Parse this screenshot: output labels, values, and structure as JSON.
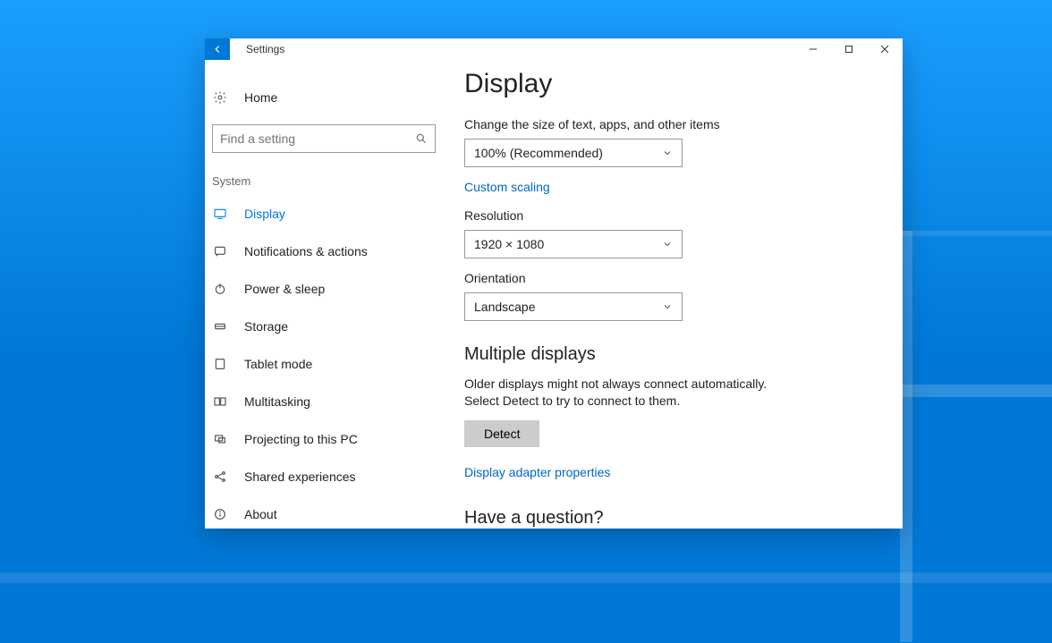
{
  "window": {
    "title": "Settings"
  },
  "sidebar": {
    "home": "Home",
    "search_placeholder": "Find a setting",
    "category": "System",
    "items": [
      {
        "key": "display",
        "label": "Display",
        "active": true
      },
      {
        "key": "notifications",
        "label": "Notifications & actions",
        "active": false
      },
      {
        "key": "power",
        "label": "Power & sleep",
        "active": false
      },
      {
        "key": "storage",
        "label": "Storage",
        "active": false
      },
      {
        "key": "tablet",
        "label": "Tablet mode",
        "active": false
      },
      {
        "key": "multitask",
        "label": "Multitasking",
        "active": false
      },
      {
        "key": "projecting",
        "label": "Projecting to this PC",
        "active": false
      },
      {
        "key": "shared",
        "label": "Shared experiences",
        "active": false
      },
      {
        "key": "about",
        "label": "About",
        "active": false
      }
    ]
  },
  "main": {
    "page_title": "Display",
    "scale_label": "Change the size of text, apps, and other items",
    "scale_value": "100% (Recommended)",
    "custom_scaling": "Custom scaling",
    "resolution_label": "Resolution",
    "resolution_value": "1920 × 1080",
    "orientation_label": "Orientation",
    "orientation_value": "Landscape",
    "multi_heading": "Multiple displays",
    "multi_text": "Older displays might not always connect automatically. Select Detect to try to connect to them.",
    "detect_button": "Detect",
    "adapter_link": "Display adapter properties",
    "question_heading": "Have a question?"
  }
}
